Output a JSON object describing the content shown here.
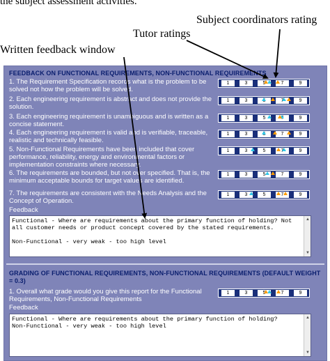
{
  "top_text": "the subject assessment activities.",
  "callouts": {
    "subject": "Subject coordinators rating",
    "tutor": "Tutor ratings",
    "feedback": "Written feedback window"
  },
  "section1": {
    "title": "FEEDBACK ON FUNCTIONAL REQUIREMENTS, NON-FUNCTIONAL REQUIREMENTS",
    "requirements": [
      {
        "text": "1. The Requirement Specification records what is the problem to be solved not how the problem will be solved.",
        "tutor": [
          5.6
        ],
        "coordinator": [
          5.2,
          6.5
        ]
      },
      {
        "text": "2. Each engineering requirement is abstract and does not provide the solution.",
        "tutor": [
          5.0,
          7.2
        ],
        "coordinator": [
          6.0,
          7.8
        ]
      },
      {
        "text": "3. Each engineering requirement is unambiguous and is written as a concise statement.",
        "tutor": [
          5.6,
          7.0
        ],
        "coordinator": [
          6.8
        ]
      },
      {
        "text": "4. Each engineering requirement is valid and is verifiable, traceable, realistic and technically feasible.",
        "tutor": [
          5.0
        ],
        "coordinator": [
          6.2,
          7.8
        ]
      },
      {
        "text": "5. Non-Functional Requirements have been included that cover performance, reliability, energy and environmental factors or implementation constraints where necessary.",
        "tutor": [
          3.8,
          7.2
        ],
        "coordinator": [
          6.6
        ]
      },
      {
        "text": "6. The requirements are bounded, but not over specified. That is, the minimum acceptable bounds for target values are identified.",
        "tutor": [
          5.4
        ],
        "coordinator": [
          6.0
        ]
      },
      {
        "text": "7. The requirements are consistent with the Needs Analysis and the Concept of Operation.",
        "tutor": [
          3.6
        ],
        "coordinator": [
          6.6,
          7.4
        ]
      }
    ],
    "feedback_label": "Feedback",
    "feedback_text": "Functional - Where are requirements about the primary function of holding? Not all customer needs or product concept covered by the stated requirements.\n\nNon-Functional - very weak - too high level"
  },
  "section2": {
    "title": "GRADING OF FUNCTIONAL REQUIREMENTS, NON-FUNCTIONAL REQUIREMENTS (DEFAULT WEIGHT = 0.3)",
    "requirements": [
      {
        "text": "1. Overall what grade would you give this report for the Functional Requirements, Non-Functional Requirements",
        "tutor": [
          5.6
        ],
        "coordinator": [
          5.2,
          6.6
        ]
      }
    ],
    "feedback_label": "Feedback",
    "feedback_text": "Functional - Where are requirements about the primary function of holding?\nNon-Functional - very weak - too high level"
  },
  "scale_labels": [
    "1",
    "3",
    "5",
    "7",
    "9"
  ],
  "colors": {
    "panel": "#7f84b8",
    "bar": "#1a2f7a",
    "tutor_marker": "#32c8e8",
    "coordinator_marker": "#ff9c00",
    "title": "#0a1e6e"
  }
}
